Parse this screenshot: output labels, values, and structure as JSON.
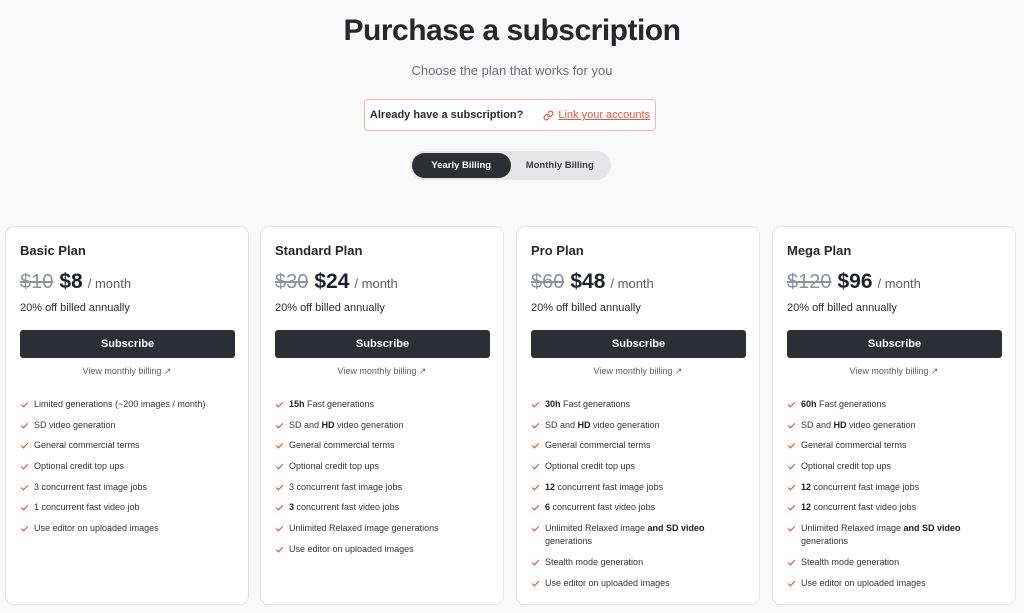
{
  "header": {
    "title": "Purchase a subscription",
    "subtitle": "Choose the plan that works for you"
  },
  "link_accounts": {
    "question": "Already have a subscription?",
    "link_label": "Link your accounts",
    "icon": "link-icon"
  },
  "billing_toggle": {
    "yearly_label": "Yearly Billing",
    "monthly_label": "Monthly Billing",
    "selected": "yearly"
  },
  "colors": {
    "accent": "#e45a3c",
    "button": "#2b2e35"
  },
  "plans": [
    {
      "name": "Basic Plan",
      "old_price": "$10",
      "price": "$8",
      "period": "/ month",
      "billed_note": "20% off billed annually",
      "subscribe_label": "Subscribe",
      "view_monthly_label": "View monthly billing ↗",
      "features": [
        {
          "bold": "",
          "text": "Limited generations (~200 images / month)"
        },
        {
          "bold": "",
          "text": "SD video generation"
        },
        {
          "bold": "",
          "text": "General commercial terms"
        },
        {
          "bold": "",
          "text": "Optional credit top ups"
        },
        {
          "bold": "",
          "text": "3 concurrent fast image jobs"
        },
        {
          "bold": "",
          "text": "1 concurrent fast video job"
        },
        {
          "bold": "",
          "text": "Use editor on uploaded images"
        }
      ]
    },
    {
      "name": "Standard Plan",
      "old_price": "$30",
      "price": "$24",
      "period": "/ month",
      "billed_note": "20% off billed annually",
      "subscribe_label": "Subscribe",
      "view_monthly_label": "View monthly billing ↗",
      "features": [
        {
          "bold": "15h",
          "text": " Fast generations"
        },
        {
          "bold": "",
          "text": "SD and <b>HD</b> video generation"
        },
        {
          "bold": "",
          "text": "General commercial terms"
        },
        {
          "bold": "",
          "text": "Optional credit top ups"
        },
        {
          "bold": "",
          "text": "3 concurrent fast image jobs"
        },
        {
          "bold": "3",
          "text": " concurrent fast video jobs"
        },
        {
          "bold": "",
          "text": "Unlimited Relaxed image generations"
        },
        {
          "bold": "",
          "text": "Use editor on uploaded images"
        }
      ]
    },
    {
      "name": "Pro Plan",
      "old_price": "$60",
      "price": "$48",
      "period": "/ month",
      "billed_note": "20% off billed annually",
      "subscribe_label": "Subscribe",
      "view_monthly_label": "View monthly billing ↗",
      "features": [
        {
          "bold": "30h",
          "text": " Fast generations"
        },
        {
          "bold": "",
          "text": "SD and <b>HD</b> video generation"
        },
        {
          "bold": "",
          "text": "General commercial terms"
        },
        {
          "bold": "",
          "text": "Optional credit top ups"
        },
        {
          "bold": "12",
          "text": " concurrent fast image jobs"
        },
        {
          "bold": "6",
          "text": " concurrent fast video jobs"
        },
        {
          "bold": "",
          "text": "Unlimited Relaxed image <b>and SD video</b> generations"
        },
        {
          "bold": "",
          "text": "Stealth mode generation"
        },
        {
          "bold": "",
          "text": "Use editor on uploaded images"
        }
      ]
    },
    {
      "name": "Mega Plan",
      "old_price": "$120",
      "price": "$96",
      "period": "/ month",
      "billed_note": "20% off billed annually",
      "subscribe_label": "Subscribe",
      "view_monthly_label": "View monthly billing ↗",
      "features": [
        {
          "bold": "60h",
          "text": " Fast generations"
        },
        {
          "bold": "",
          "text": "SD and <b>HD</b> video generation"
        },
        {
          "bold": "",
          "text": "General commercial terms"
        },
        {
          "bold": "",
          "text": "Optional credit top ups"
        },
        {
          "bold": "12",
          "text": " concurrent fast image jobs"
        },
        {
          "bold": "12",
          "text": " concurrent fast video jobs"
        },
        {
          "bold": "",
          "text": "Unlimited Relaxed image <b>and SD video</b> generations"
        },
        {
          "bold": "",
          "text": "Stealth mode generation"
        },
        {
          "bold": "",
          "text": "Use editor on uploaded images"
        }
      ]
    }
  ]
}
